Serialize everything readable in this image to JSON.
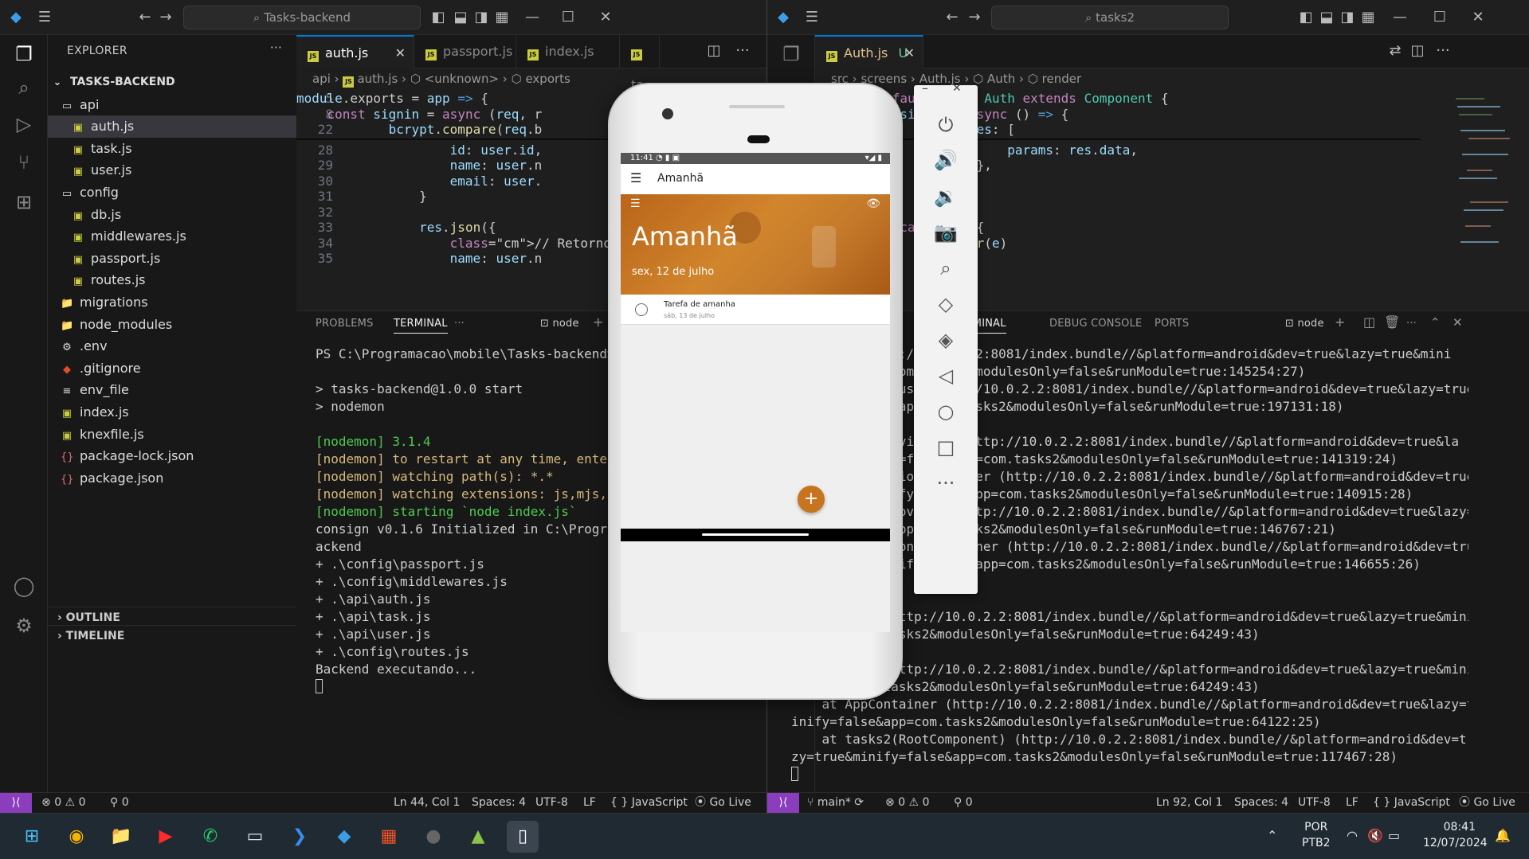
{
  "left": {
    "search": "Tasks-backend",
    "explorer_title": "EXPLORER",
    "workspace": "TASKS-BACKEND",
    "tree": [
      {
        "label": "api",
        "type": "folder",
        "indent": 1
      },
      {
        "label": "auth.js",
        "type": "js",
        "indent": 2,
        "selected": true
      },
      {
        "label": "task.js",
        "type": "js",
        "indent": 2
      },
      {
        "label": "user.js",
        "type": "js",
        "indent": 2
      },
      {
        "label": "config",
        "type": "folder",
        "indent": 1
      },
      {
        "label": "db.js",
        "type": "js",
        "indent": 2
      },
      {
        "label": "middlewares.js",
        "type": "js",
        "indent": 2
      },
      {
        "label": "passport.js",
        "type": "js",
        "indent": 2
      },
      {
        "label": "routes.js",
        "type": "js",
        "indent": 2
      },
      {
        "label": "migrations",
        "type": "folder-closed",
        "indent": 1
      },
      {
        "label": "node_modules",
        "type": "folder-closed",
        "indent": 1
      },
      {
        "label": ".env",
        "type": "env",
        "indent": 1
      },
      {
        "label": ".gitignore",
        "type": "git",
        "indent": 1
      },
      {
        "label": "env_file",
        "type": "file",
        "indent": 1
      },
      {
        "label": "index.js",
        "type": "js",
        "indent": 1
      },
      {
        "label": "knexfile.js",
        "type": "js",
        "indent": 1
      },
      {
        "label": "package-lock.json",
        "type": "json",
        "indent": 1
      },
      {
        "label": "package.json",
        "type": "json",
        "indent": 1
      }
    ],
    "outline": "OUTLINE",
    "timeline": "TIMELINE",
    "tabs": [
      "auth.js",
      "passport.js",
      "index.js",
      "ta"
    ],
    "breadcrumb": [
      "api",
      "auth.js",
      "<unknown>",
      "exports"
    ],
    "code_lines": [
      {
        "n": "5",
        "t": "module.exports = app => {"
      },
      {
        "n": "8",
        "t": "    const signin = async (req, r"
      },
      {
        "n": "22",
        "t": "            bcrypt.compare(req.b"
      },
      {
        "n": "28",
        "t": "                    id: user.id,"
      },
      {
        "n": "29",
        "t": "                    name: user.n"
      },
      {
        "n": "30",
        "t": "                    email: user."
      },
      {
        "n": "31",
        "t": "                }"
      },
      {
        "n": "32",
        "t": ""
      },
      {
        "n": "33",
        "t": "                res.json({"
      },
      {
        "n": "34",
        "t": "                    // Retorno p"
      },
      {
        "n": "35",
        "t": "                    name: user.n"
      }
    ],
    "panel_tabs": [
      "PROBLEMS",
      "TERMINAL"
    ],
    "terminal_label": "node",
    "terminal_lines": [
      "PS C:\\Programacao\\mobile\\Tasks-backend> n",
      "",
      "> tasks-backend@1.0.0 start",
      "> nodemon",
      "",
      "[nodemon] 3.1.4",
      "[nodemon] to restart at any time, enter `",
      "[nodemon] watching path(s): *.*",
      "[nodemon] watching extensions: js,mjs,cjs",
      "[nodemon] starting `node index.js`",
      "consign v0.1.6 Initialized in C:\\Programa",
      "ackend",
      "+ .\\config\\passport.js",
      "+ .\\config\\middlewares.js",
      "+ .\\api\\auth.js",
      "+ .\\api\\task.js",
      "+ .\\api\\user.js",
      "+ .\\config\\routes.js",
      "Backend executando..."
    ],
    "status": {
      "errors": "0",
      "warnings": "0",
      "ports": "0",
      "pos": "Ln 44, Col 1",
      "spaces": "Spaces: 4",
      "enc": "UTF-8",
      "eol": "LF",
      "lang": "JavaScript",
      "live": "Go Live"
    }
  },
  "right": {
    "search": "tasks2",
    "tab": "Auth.js",
    "tab_badge": "U",
    "breadcrumb": [
      "src",
      "screens",
      "Auth.js",
      "Auth",
      "render"
    ],
    "code_lines": [
      {
        "t": "export default class Auth extends Component {"
      },
      {
        "t": "    const signin = async () => {"
      },
      {
        "t": "                routes: ["
      },
      {
        "t": "                        params: res.data,"
      },
      {
        "t": "                    },"
      },
      {
        "t": "                ],"
      },
      {
        "t": "            })"
      },
      {
        "t": ""
      },
      {
        "t": "        } catch (e) {"
      },
      {
        "t": "            showError(e)"
      }
    ],
    "panel_tabs": [
      "TERMINAL",
      "DEBUG CONSOLE",
      "PORTS"
    ],
    "terminal_label": "node",
    "terminal_lines": [
      "    at p (http://10.0.2.2:8081/index.bundle//&platform=android&dev=true&lazy=true&mini",
      "fy=false&app=com.tasks2&modulesOnly=false&runModule=true:145254:27)",
      "    at Anonymous (http://10.0.2.2:8081/index.bundle//&platform=android&dev=true&lazy=true",
      "&minify=false&app=com.tasks2&modulesOnly=false&runModule=true:197131:18)",
      "",
      "    at StackNavigator (http://10.0.2.2:8081/index.bundle//&platform=android&dev=true&la",
      "zy=true&minify=false&app=com.tasks2&modulesOnly=false&runModule=true:141319:24)",
      "    at NavigationContainer (http://10.0.2.2:8081/index.bundle//&platform=android&dev=true&",
      "lazy=true&minify=false&app=com.tasks2&modulesOnly=false&runModule=true:140915:28)",
      "    at ThemeProvider (http://10.0.2.2:8081/index.bundle//&platform=android&dev=true&lazy=true&",
      "minify=false&app=com.tasks2&modulesOnly=false&runModule=true:146767:21)",
      "    at PortalContainerInner (http://10.0.2.2:8081/index.bundle//&platform=android&dev=true",
      "&lazy=true&minify=false&app=com.tasks2&modulesOnly=false&runModule=true:146655:26)",
      "",
      "    at RCTView",
      "    at View (http://10.0.2.2:8081/index.bundle//&platform=android&dev=true&lazy=true&minify=fa",
      "lse&app=com.tasks2&modulesOnly=false&runModule=true:64249:43)",
      "    at RCTView",
      "    at View (http://10.0.2.2:8081/index.bundle//&platform=android&dev=true&lazy=true&minify=fa",
      "lse&app=com.tasks2&modulesOnly=false&runModule=true:64249:43)",
      "    at AppContainer (http://10.0.2.2:8081/index.bundle//&platform=android&dev=true&lazy=true&m",
      "inify=false&app=com.tasks2&modulesOnly=false&runModule=true:64122:25)",
      "    at tasks2(RootComponent) (http://10.0.2.2:8081/index.bundle//&platform=android&dev=true&la",
      "zy=true&minify=false&app=com.tasks2&modulesOnly=false&runModule=true:117467:28)"
    ],
    "status": {
      "branch": "main*",
      "errors": "0",
      "warnings": "0",
      "ports": "0",
      "pos": "Ln 92, Col 1",
      "spaces": "Spaces: 4",
      "enc": "UTF-8",
      "eol": "LF",
      "lang": "JavaScript",
      "live": "Go Live"
    }
  },
  "phone": {
    "time": "11:41",
    "appbar_title": "Amanhã",
    "header_title": "Amanhã",
    "header_date": "sex, 12 de julho",
    "task_title": "Tarefa de amanha",
    "task_date": "sáb, 13 de julho",
    "fab": "+",
    "accent": "#c8741f"
  },
  "taskbar": {
    "lang1": "POR",
    "lang2": "PTB2",
    "time": "08:41",
    "date": "12/07/2024"
  }
}
